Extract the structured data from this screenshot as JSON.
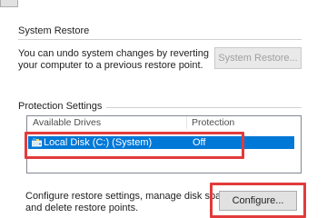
{
  "system_restore": {
    "title": "System Restore",
    "description_line1": "You can undo system changes by reverting",
    "description_line2": "your computer to a previous restore point.",
    "button_label": "System Restore..."
  },
  "protection": {
    "title": "Protection Settings",
    "columns": [
      "Available Drives",
      "Protection"
    ],
    "rows": [
      {
        "drive": "Local Disk (C:) (System)",
        "protection": "Off",
        "selected": true
      }
    ]
  },
  "configure": {
    "description_line1": "Configure restore settings, manage disk space,",
    "description_line2": "and delete restore points.",
    "button_label": "Configure..."
  },
  "colors": {
    "selection": "#0078d7",
    "highlight": "#e23b3b"
  }
}
